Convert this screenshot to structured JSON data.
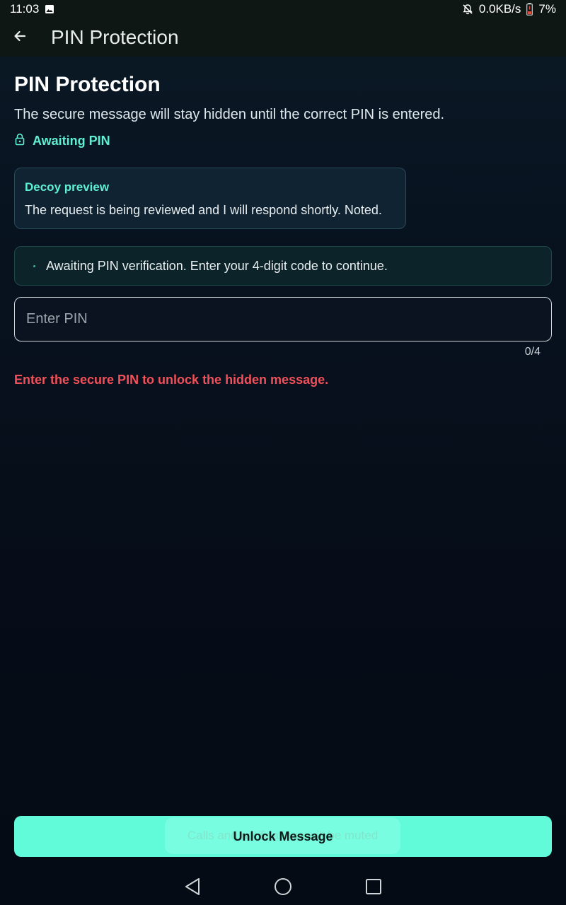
{
  "status_bar": {
    "time": "11:03",
    "network_speed": "0.0KB/s",
    "battery": "7%",
    "icons": [
      "image-notification-icon",
      "muted-bell-icon",
      "battery-low-icon"
    ]
  },
  "app_bar": {
    "title": "PIN Protection",
    "back_icon": "arrow-left-icon"
  },
  "main": {
    "title": "PIN Protection",
    "subtitle": "The secure message will stay hidden until the correct PIN is entered.",
    "status_label": "Awaiting PIN",
    "decoy": {
      "title": "Decoy preview",
      "text": "The request is being reviewed and I will respond shortly. Noted."
    },
    "verification_text": "Awaiting PIN verification. Enter your 4-digit code to continue.",
    "pin_input": {
      "placeholder": "Enter PIN",
      "value": "",
      "counter": "0/4"
    },
    "error": "Enter the secure PIN to unlock the hidden message."
  },
  "actions": {
    "unlock_label": "Unlock Message"
  },
  "toast": {
    "text": "Calls and notifications will be muted"
  },
  "nav_bar": {
    "icons": [
      "back-triangle-icon",
      "home-circle-icon",
      "recents-square-icon"
    ]
  },
  "colors": {
    "accent": "#62fbd9",
    "status_green": "#5ff0d4",
    "error_red": "#f0505a",
    "background": "#081320"
  }
}
